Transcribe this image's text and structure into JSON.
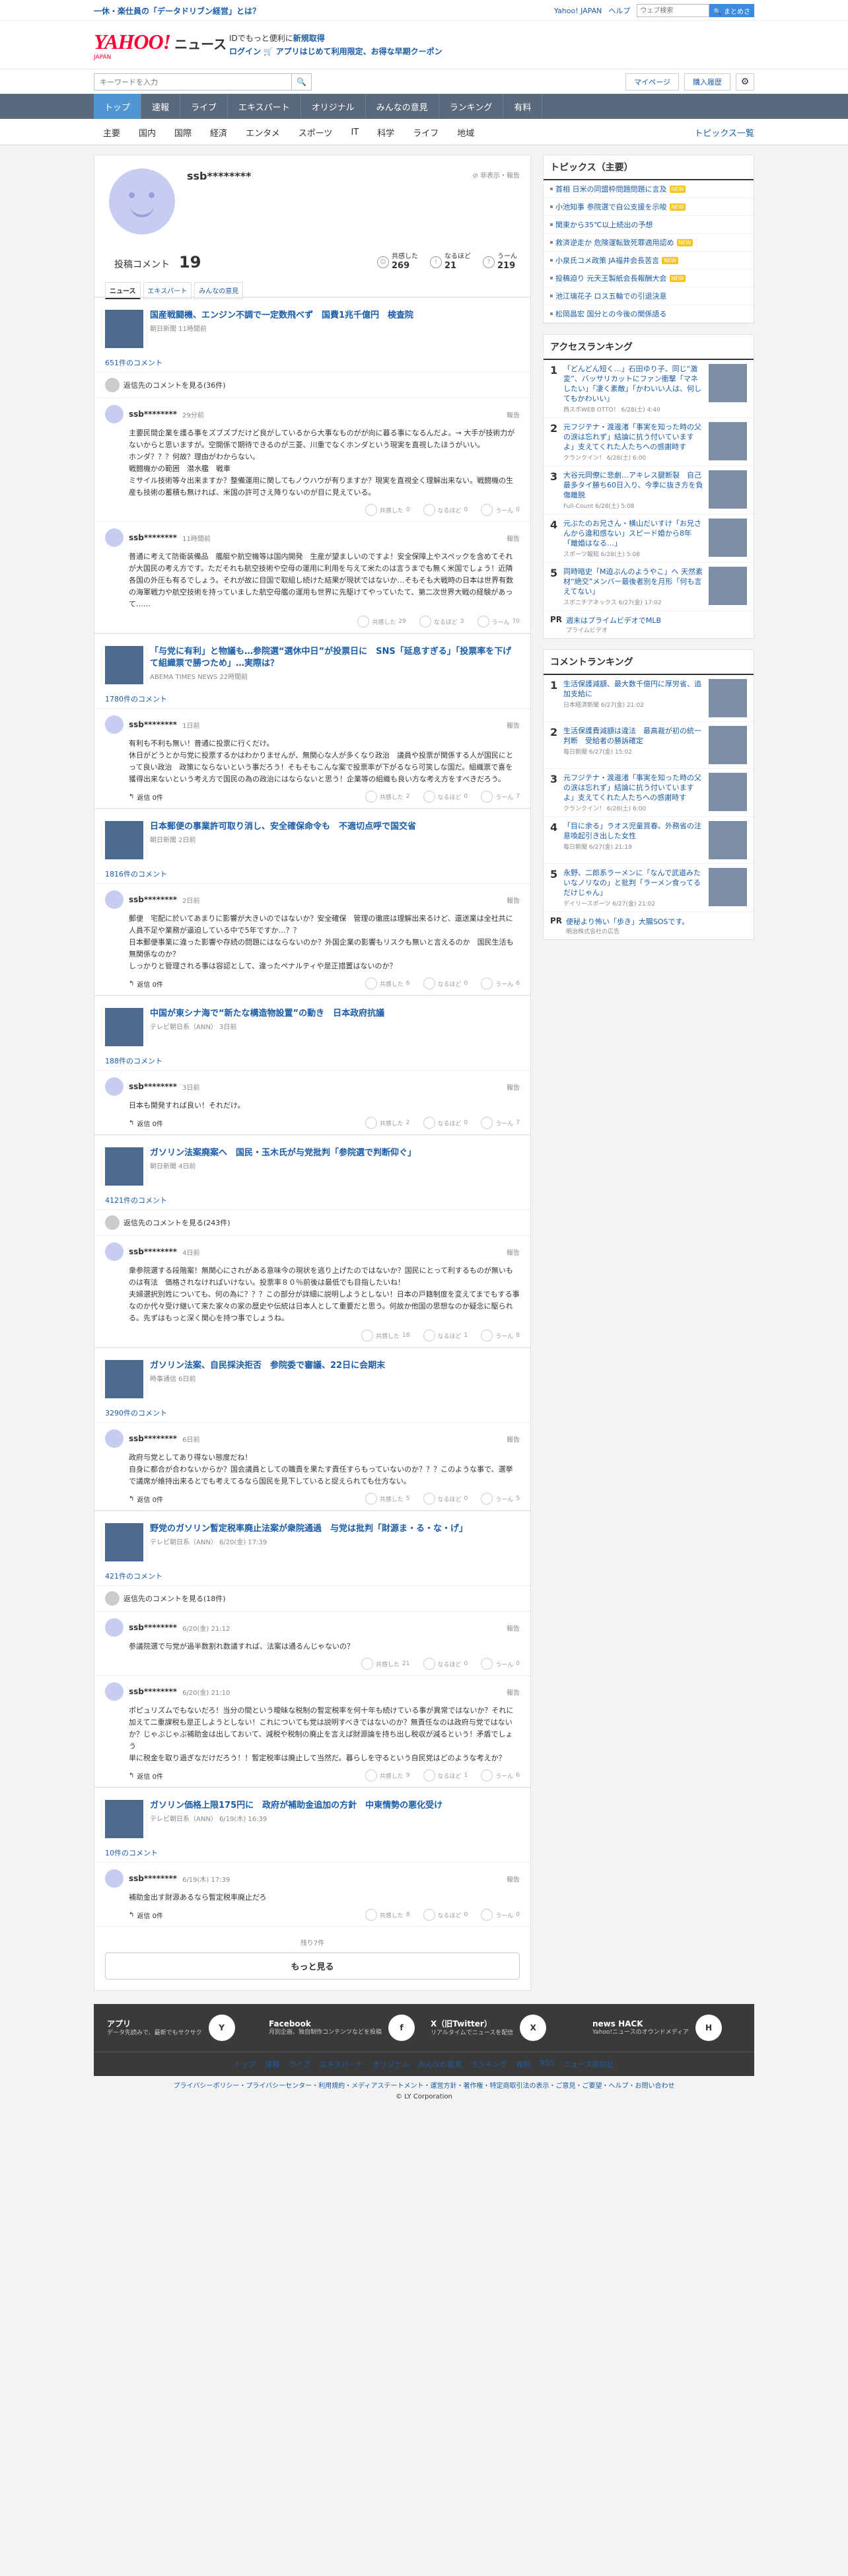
{
  "topbar": {
    "promo": "一休・楽仕員の「データドリブン経営」とは？",
    "yahoo": "Yahoo! JAPAN",
    "help": "ヘルプ",
    "search_placeholder": "ウェブ検索",
    "search_btn": "🔍 まとめさ"
  },
  "header": {
    "logo": "YAHOO!",
    "logo_sub": "ニュース",
    "logo_jp": "JAPAN",
    "line1_a": "IDでもっと便利に",
    "line1_b": "新規取得",
    "line2_a": "ログイン",
    "line2_b": "アプリはじめて利用限定、お得な早期クーポン"
  },
  "searchbar": {
    "placeholder": "キーワードを入力",
    "mypage": "マイページ",
    "history": "購入履歴"
  },
  "gnav": [
    "トップ",
    "速報",
    "ライブ",
    "エキスパート",
    "オリジナル",
    "みんなの意見",
    "ランキング",
    "有料"
  ],
  "cnav": [
    "主要",
    "国内",
    "国際",
    "経済",
    "エンタメ",
    "スポーツ",
    "IT",
    "科学",
    "ライフ",
    "地域"
  ],
  "cnav_right": "トピックス一覧",
  "profile": {
    "name": "ssb********",
    "tools": "⊘ 非表示・報告",
    "count_label": "投稿コメント",
    "count": "19",
    "stats": [
      {
        "t": "共感した",
        "v": "269"
      },
      {
        "t": "なるほど",
        "v": "21"
      },
      {
        "t": "うーん",
        "v": "219"
      }
    ],
    "tabs": [
      "ニュース",
      "エキスパート",
      "みんなの意見"
    ]
  },
  "articles": [
    {
      "title": "国産戦闘機、エンジン不調で一定数飛べず　国費1兆千億円　検査院",
      "src": "朝日新聞 11時間前",
      "count": "651件のコメント",
      "replies": "返信先のコメントを見る(36件)",
      "comments": [
        {
          "name": "ssb********",
          "date": "29分前",
          "body": "主要民間企業を護る事をズブズブだけど良がしているから大事なものがが向に暮る事になるんだよ。→ 大手が技術力がないからと思いますが。空開係で期待できるのが三菱、川重でなくホンダという現実を直視したほうがいい。\nホンダ？？？何故？理由がわからない。\n戦闘機かの範囲　潜水艦　戦車\nミサイル技術等々出来ますか？整備運用に関してもノウハウが有りますか？現実を直視全く理解出来ない。戦闘機の生産も技術の蓄積も無ければ、米国の許可さえ降りないのが目に見えている。",
          "r": [
            "0",
            "0",
            "0"
          ],
          "reply": ""
        },
        {
          "name": "ssb********",
          "date": "11時間前",
          "body": "普通に考えて防衛装備品　艦艇や航空機等は国内開発　生産が望ましいのですよ！安全保障上やスペックを含めてそれが大国民の考え方です。ただそれも航空技術や空母の運用に利用を与えて米たのは言うまでも無く米国でしょう！近隣各国の外圧も有るでしょう。それが故に目国で取組し続けた結果が現状ではないか…そもそも大戦時の日本は世界有数の海軍戦力や航空技術を持っていました航空母艦の運用も世界に先駆けてやっていたて、第二次世界大戦の経験があって……",
          "r": [
            "29",
            "3",
            "70"
          ],
          "reply": ""
        }
      ]
    },
    {
      "title": "「与党に有利」と物議も…参院選“選休中日”が投票日に　SNS「延息すぎる」「投票率を下げて組織票で勝つため」…実際は？",
      "src": "ABEMA TIMES NEWS 22時間前",
      "count": "1780件のコメント",
      "replies": "",
      "comments": [
        {
          "name": "ssb********",
          "date": "1日前",
          "body": "有利も不利も無い！普通に投票に行くだけ。\n休日がどうとか与党に投票するかはわかりませんが、無関心な人が多くなり政治　議員や投票が関係する人が国民にとって良い政治　政策にならないという事だろう！そもそもこんな案で投票率が下がるなら可笑しな国だ。組織票で喜を獲得出来ないという考え方で国民の為の政治にはならないと思う！企業等の組織も良い方な考え方をすべきだろう。",
          "r": [
            "2",
            "0",
            "7"
          ],
          "reply": "返信 0件"
        }
      ]
    },
    {
      "title": "日本郵便の事業許可取り消し、安全確保命令も　不適切点呼で国交省",
      "src": "朝日新聞 2日前",
      "count": "1816件のコメント",
      "replies": "",
      "comments": [
        {
          "name": "ssb********",
          "date": "2日前",
          "body": "郵便　宅配に於いてあまりに影響が大きいのではないか？安全確保　管理の徹底は理解出来るけど、還送業は全社共に人員不足や業務が逼迫している中で5年ですか…？？\n日本郵便事業に違った影響や存続の問題にはならないのか？外国企業の影響もリスクも無いと言えるのか　国民生活も無関係なのか？\nしっかりと管理される事は容認として、違ったペナルティや是正措置はないのか？",
          "r": [
            "6",
            "0",
            "6"
          ],
          "reply": "返信 0件"
        }
      ]
    },
    {
      "title": "中国が東シナ海で“新たな構造物設置”の動き　日本政府抗議",
      "src": "テレビ朝日系（ANN） 3日前",
      "count": "188件のコメント",
      "replies": "",
      "comments": [
        {
          "name": "ssb********",
          "date": "3日前",
          "body": "日本も開発すれば良い！それだけ。",
          "r": [
            "2",
            "0",
            "7"
          ],
          "reply": "返信 0件"
        }
      ]
    },
    {
      "title": "ガソリン法案廃案へ　国民・玉木氏が与党批判「参院選で判断仰ぐ」",
      "src": "朝日新聞 4日前",
      "count": "4121件のコメント",
      "replies": "返信先のコメントを見る(243件)",
      "comments": [
        {
          "name": "ssb********",
          "date": "4日前",
          "body": "衆参院選する段階案！無関心にされがある意味今の現状を逃り上げたのではないか？国民にとって利するものが無いものは有法　価格されなければいけない。投票率８０％前後は最低でも目指したいね！\n夫婦選択別姓についても、何の為に？？？この部分が詳細に説明しようとしない！日本の戸籍制度を変えてまでもする事なのか代々受け継いて来た家々の家の歴史や伝統は日本人として重要だと思う。何故か他国の思想なのか疑念に駆られる。先ずはもっと深く関心を持つ事でしょうね。",
          "r": [
            "18",
            "1",
            "8"
          ],
          "reply": ""
        }
      ]
    },
    {
      "title": "ガソリン法案、自民採決拒否　参院委で審議、22日に会期末",
      "src": "時事通信 6日前",
      "count": "3290件のコメント",
      "replies": "",
      "comments": [
        {
          "name": "ssb********",
          "date": "6日前",
          "body": "政府与党としてあり得ない態度だね！\n自身に都合が合わないからか？国会議員としての職責を果たす責任すらもっていないのか？？？このような事で、選挙で議席が維持出来るとでも考えてるなら国民を見下していると捉えられても仕方ない。",
          "r": [
            "5",
            "0",
            "5"
          ],
          "reply": "返信 0件"
        }
      ]
    },
    {
      "title": "野党のガソリン暫定税率廃止法案が衆院通過　与党は批判「財源ま・る・な・げ」",
      "src": "テレビ朝日系（ANN） 6/20(金) 17:39",
      "count": "421件のコメント",
      "replies": "返信先のコメントを見る(18件)",
      "comments": [
        {
          "name": "ssb********",
          "date": "6/20(金) 21:12",
          "body": "参議院選で与党が過半数割れ数議すれば、法案は通るんじゃないの？",
          "r": [
            "21",
            "0",
            "0"
          ],
          "reply": ""
        },
        {
          "name": "ssb********",
          "date": "6/20(金) 21:10",
          "body": "ポピュリズムでもないだろ！当分の間という曖昧な税制の暫定税率を何十年も続けている事が異常ではないか？それに加えて二重課税も是正しようとしない！これについても党は説明すべきではないのか？無責任なのは政府与党ではないか？じゃぶじゃぶ補助金は出しておいて、減税や税制の廃止を言えば財源論を持ち出し税収が減るという！矛盾でしょう\n単に税金を取り過ぎなだけだろう！！暫定税率は廃止して当然だ。暮らしを守るという自民党はどのような考えか？",
          "r": [
            "9",
            "1",
            "6"
          ],
          "reply": "返信 0件"
        }
      ]
    },
    {
      "title": "ガソリン価格上限175円に　政府が補助金追加の方針　中東情勢の悪化受け",
      "src": "テレビ朝日系（ANN） 6/19(木) 16:39",
      "count": "10件のコメント",
      "replies": "",
      "comments": [
        {
          "name": "ssb********",
          "date": "6/19(木) 17:39",
          "body": "補助金出す財源あるなら暫定税率廃止だろ",
          "r": [
            "8",
            "0",
            "0"
          ],
          "reply": "返信 0件"
        }
      ]
    }
  ],
  "more": {
    "remain": "残り7件",
    "button": "もっと見る"
  },
  "topics": {
    "title": "トピックス（主要）",
    "items": [
      {
        "t": "首相 日米の同盟枠問題問題に言及",
        "b": "NEW"
      },
      {
        "t": "小池知事 参院選で自公支援を示唆",
        "b": "NEW"
      },
      {
        "t": "関東から35℃以上続出の予想",
        "b": ""
      },
      {
        "t": "救済逆走か 危険運転致死罪適用認め",
        "b": "NEW"
      },
      {
        "t": "小泉氏コメ政策 JA福井会長苦言",
        "b": "NEW"
      },
      {
        "t": "投稿迫り 元天王製紙会長報酬大会",
        "b": "NEW"
      },
      {
        "t": "池江璃花子 ロス五輪での引退決意",
        "b": ""
      },
      {
        "t": "松岡昌宏 国分との今後の関係語る",
        "b": ""
      }
    ]
  },
  "access": {
    "title": "アクセスランキング",
    "items": [
      {
        "t": "「どんどん短く…」石田ゆり子、同じ“激変”、バッサリカットにファン衝撃「マネしたい」「凄く素敵」「かわいい人は、何してもかわいい」",
        "s": "西スポWEB OTTO！ 6/28(土) 4:40"
      },
      {
        "t": "元フジテナ・渡邊渚「事実を知った時の父の涙は忘れず」結論に抗う付いていますよ」支えてくれた人たちへの感謝時す",
        "s": "クランクイン！ 6/28(土) 6:00"
      },
      {
        "t": "大谷元同僚に悲劇…アキレス腱断裂　自己最多タイ勝ち60日入り、今季に抜き方を負傷離脱",
        "s": "Full-Count 6/28(土) 5:08"
      },
      {
        "t": "元ぶたのお兄さん・横山だいすけ「お兄さんから違和感ない」スピード婚から8年「離婚はなる…」",
        "s": "スポーツ報知 6/28(土) 5:08"
      },
      {
        "t": "同時暗史「M迫ぶんのようやこ」へ 天然素材“絶交”メンバー最後者別を月形「何も言えてない」",
        "s": "スポニチアネックス 6/27(金) 17:02"
      }
    ],
    "pr": {
      "tag": "PR",
      "t": "週末はプライムビデオでMLB",
      "s": "プライムビデオ"
    }
  },
  "commentrank": {
    "title": "コメントランキング",
    "items": [
      {
        "t": "生活保護減額、最大数千億円に厚労省、追加支給に",
        "s": "日本経済新聞 6/27(金) 21:02"
      },
      {
        "t": "生活保護費減額は違法　最高裁が初の統一判断　受給者の勝訴確定",
        "s": "毎日新聞 6/27(金) 15:02"
      },
      {
        "t": "元フジテナ・渡邊渚「事実を知った時の父の涙は忘れず」結論に抗う付いていますよ」支えてくれた人たちへの感謝時す",
        "s": "クランクイン！ 6/28(土) 6:00"
      },
      {
        "t": "「目に余る」ラオス児童買春、外務省の注意喚起引き出した女性",
        "s": "毎日新聞 6/27(金) 21:19"
      },
      {
        "t": "永野、二郎系ラーメンに「なんで武道みたいなノリなの」と批判「ラーメン食ってるだけじゃん」",
        "s": "デイリースポーツ 6/27(金) 21:02"
      }
    ],
    "pr": {
      "tag": "PR",
      "t": "便秘より怖い「歩き」大腸SOSです。",
      "s": "明治株式会社の広告"
    }
  },
  "footer": {
    "apps": [
      {
        "t": "アプリ",
        "d": "データ先読みで、最新でもサクサク",
        "ic": "Y"
      },
      {
        "t": "Facebook",
        "d": "月別企画、独自制作コンテンツなどを投稿",
        "ic": "f"
      },
      {
        "t": "X（旧Twitter）",
        "d": "リアルタイムでニュースを配信",
        "ic": "X"
      },
      {
        "t": "news HACK",
        "d": "Yahoo!ニュースのオウンドメディア",
        "ic": "H"
      }
    ],
    "links": [
      "トップ",
      "速報",
      "ライブ",
      "エキスパート",
      "オリジナル",
      "みんなの意見",
      "ランキング",
      "有料",
      "RSS",
      "ニュース提供社"
    ],
    "legal": "プライバシーポリシー・プライバシーセンター・利用規約・メディアステートメント・運営方針・著作権・特定商取引法の表示・ご意見・ご要望・ヘルプ・お問い合わせ",
    "copy": "© LY Corporation"
  }
}
